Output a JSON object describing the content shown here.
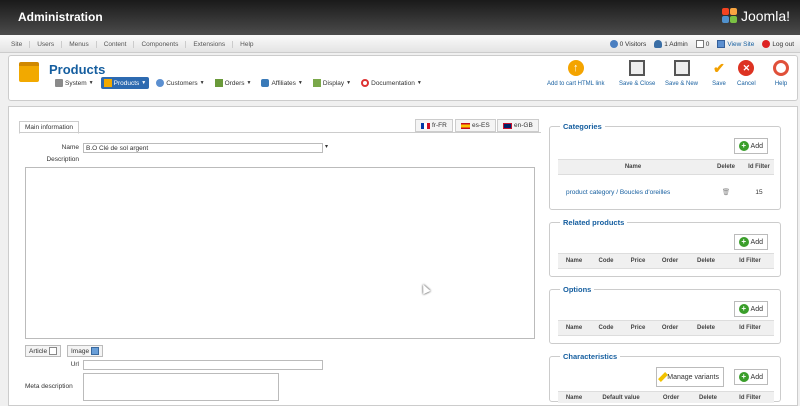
{
  "header": {
    "title": "Administration",
    "logo_text": "Joomla!"
  },
  "menu": [
    "Site",
    "Users",
    "Menus",
    "Content",
    "Components",
    "Extensions",
    "Help"
  ],
  "status": {
    "visitors": "0 Visitors",
    "admin": "1 Admin",
    "messages": "0",
    "view_site": "View Site",
    "logout": "Log out"
  },
  "page": {
    "title": "Products"
  },
  "submenu": [
    "System",
    "Products",
    "Customers",
    "Orders",
    "Affiliates",
    "Display",
    "Documentation"
  ],
  "toolbar": {
    "add_cart": "Add to cart HTML link",
    "save_close": "Save & Close",
    "save_new": "Save & New",
    "save": "Save",
    "cancel": "Cancel",
    "help": "Help"
  },
  "tabs": {
    "main": "Main information",
    "fr": "fr-FR",
    "es": "es-ES",
    "en": "en-GB"
  },
  "form": {
    "name_label": "Name",
    "name_value": "B.O Clé de sol argent",
    "description_label": "Description",
    "article_btn": "Article",
    "image_btn": "Image",
    "url_label": "Url",
    "meta_label": "Meta description"
  },
  "categories": {
    "title": "Categories",
    "add": "Add",
    "cols": [
      "Name",
      "Delete",
      "Id Filter"
    ],
    "row": {
      "name": "product category / Boucles d'oreilles",
      "id": "15"
    }
  },
  "related": {
    "title": "Related products",
    "add": "Add",
    "cols": [
      "Name",
      "Code",
      "Price",
      "Order",
      "Delete",
      "Id Filter"
    ]
  },
  "options": {
    "title": "Options",
    "add": "Add",
    "cols": [
      "Name",
      "Code",
      "Price",
      "Order",
      "Delete",
      "Id Filter"
    ]
  },
  "characteristics": {
    "title": "Characteristics",
    "manage": "Manage variants",
    "add": "Add",
    "cols": [
      "Name",
      "Default value",
      "Order",
      "Delete",
      "Id Filter"
    ]
  }
}
